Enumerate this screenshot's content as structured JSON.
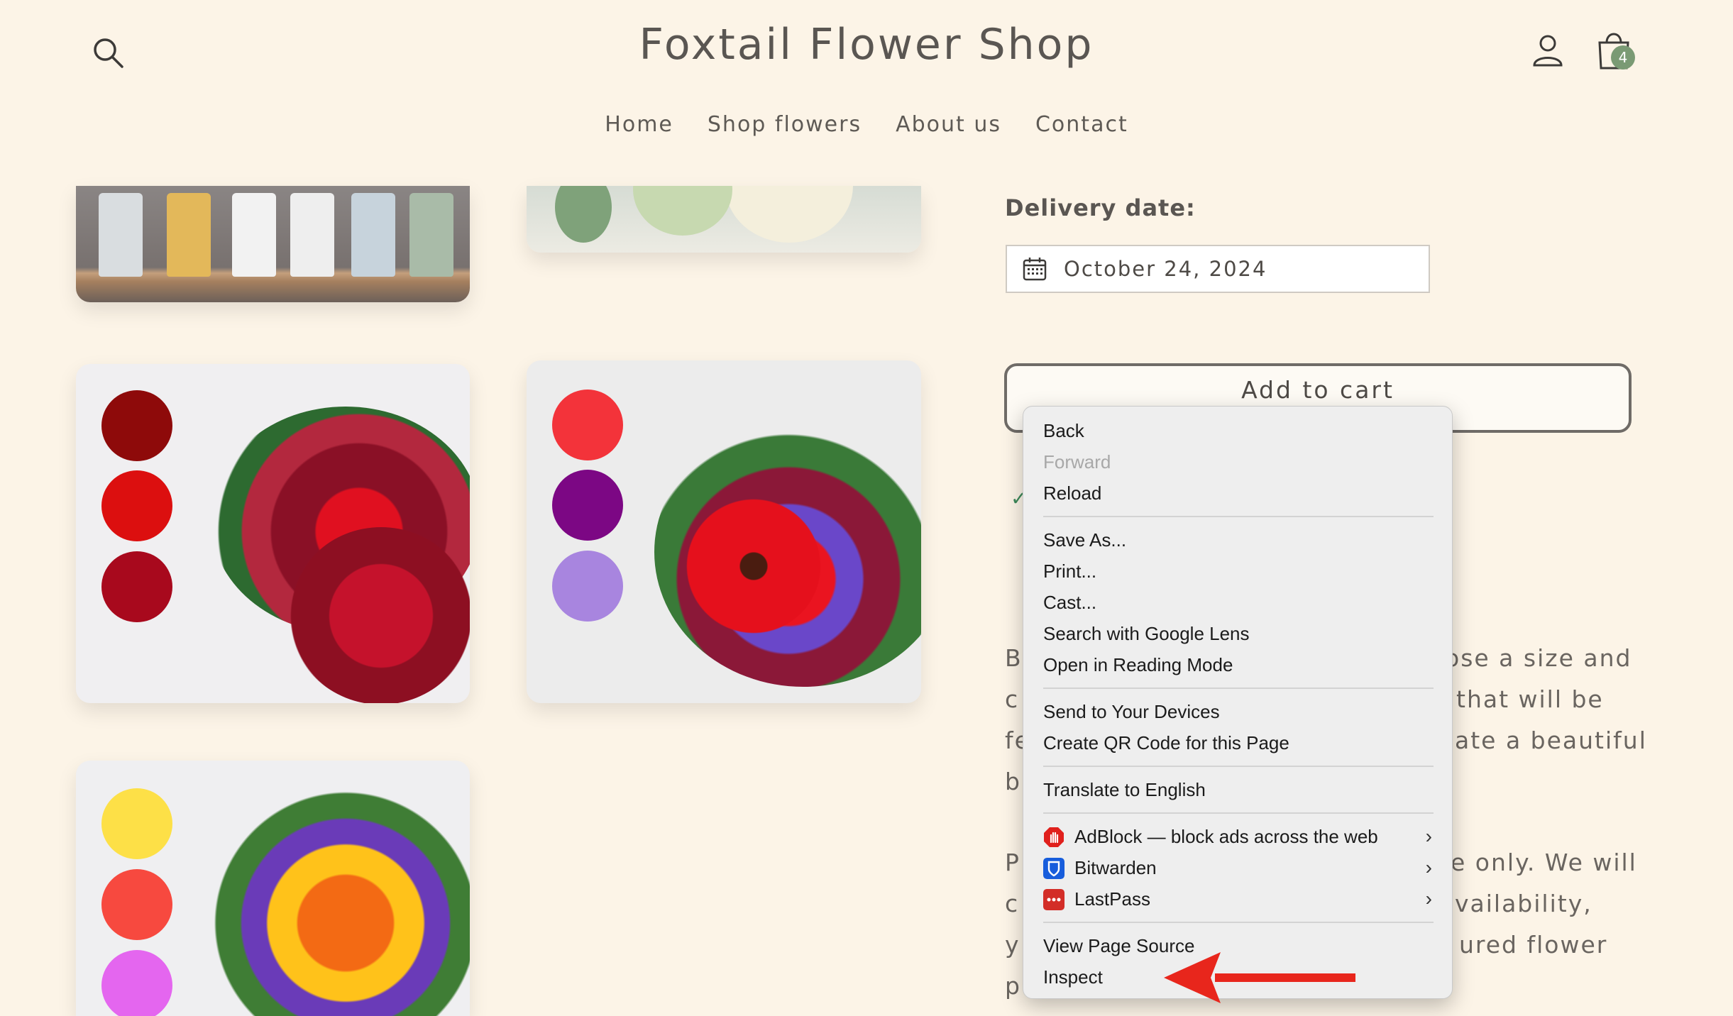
{
  "header": {
    "title": "Foxtail Flower Shop",
    "cart_count": "4"
  },
  "nav": {
    "items": [
      "Home",
      "Shop flowers",
      "About us",
      "Contact"
    ]
  },
  "gallery": {
    "swatches": {
      "red": [
        "#8e0a0a",
        "#dc0f0f",
        "#a8091d"
      ],
      "purple": [
        "#f3333a",
        "#7c0784",
        "#a885df"
      ],
      "yellow": [
        "#fde047",
        "#f7493f",
        "#e466ef"
      ]
    }
  },
  "product": {
    "delivery_label": "Delivery date:",
    "delivery_date": "October 24, 2024",
    "add_to_cart": "Add to cart",
    "desc_fragments": {
      "p1": [
        "Bu",
        "ose a size and",
        "c",
        "that will be",
        "fe",
        "ate a beautiful",
        "b"
      ],
      "p2": [
        "Pl",
        "e only. We will",
        "c",
        "vailability,",
        "y",
        "ured flower",
        "p"
      ]
    }
  },
  "context_menu": {
    "items": {
      "back": "Back",
      "forward": "Forward",
      "reload": "Reload",
      "save_as": "Save As...",
      "print": "Print...",
      "cast": "Cast...",
      "search_lens": "Search with Google Lens",
      "reading_mode": "Open in Reading Mode",
      "send_devices": "Send to Your Devices",
      "qr_code": "Create QR Code for this Page",
      "translate": "Translate to English",
      "adblock": "AdBlock — block ads across the web",
      "bitwarden": "Bitwarden",
      "lastpass": "LastPass",
      "view_source": "View Page Source",
      "inspect": "Inspect"
    },
    "icons": [
      "adblock-icon",
      "bitwarden-icon",
      "lastpass-icon"
    ]
  },
  "colors": {
    "background": "#fcf4e7",
    "cart_badge": "#7a9a74",
    "annotation_arrow": "#e8261c"
  }
}
